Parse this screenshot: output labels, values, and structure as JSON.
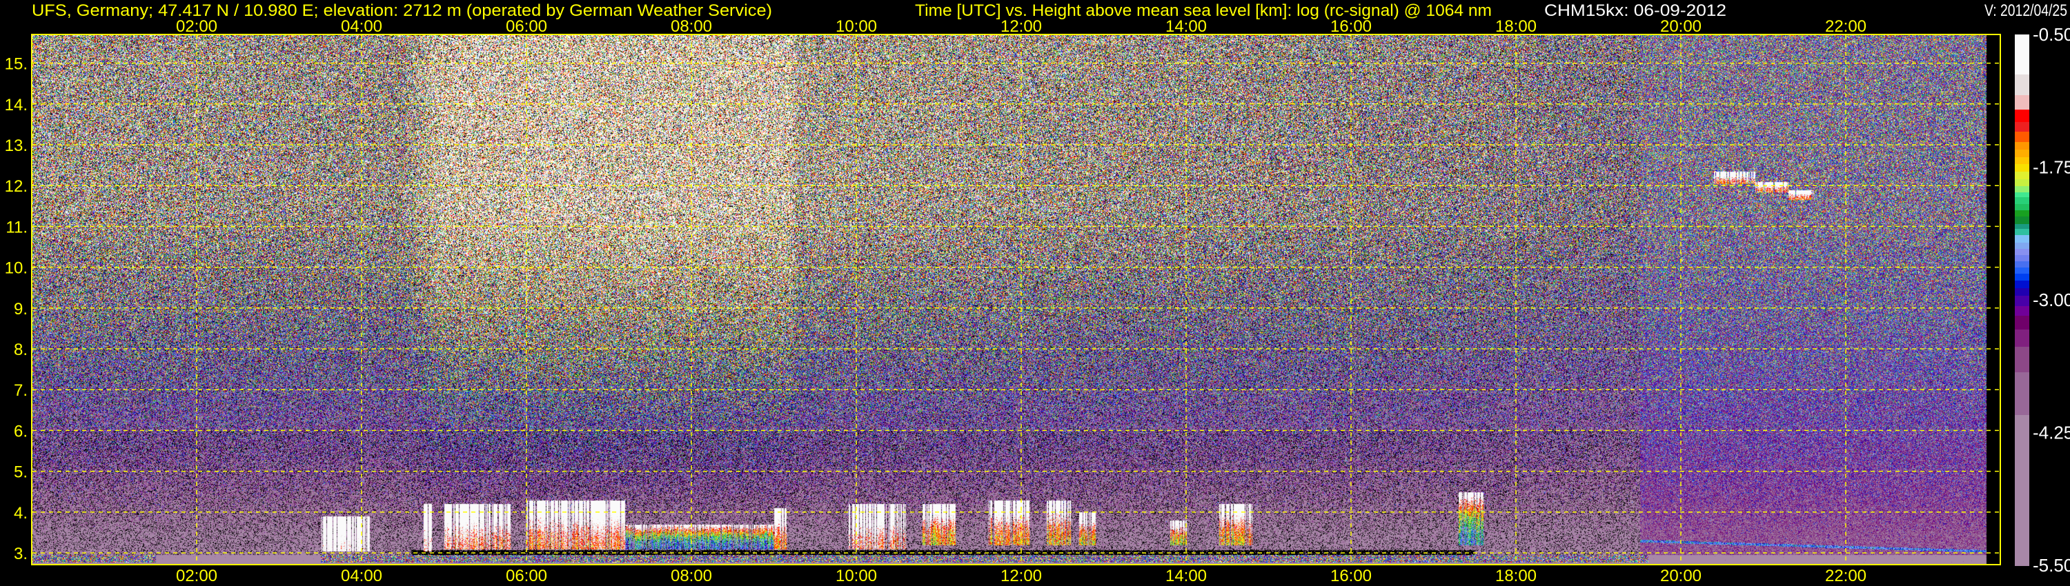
{
  "header": {
    "station": "UFS, Germany; 47.417 N / 10.980 E; elevation: 2712 m  (operated by German Weather Service)",
    "instrument": "CHM15kx: 06-09-2012",
    "version": "V: 2012/04/25"
  },
  "chart_data": {
    "type": "heatmap",
    "title": "Time [UTC] vs. Height above mean sea level [km]: log (rc-signal) @ 1064 nm",
    "xlabel": "Time [UTC]",
    "ylabel": "Height above mean sea level [km]",
    "xlim": [
      0,
      24
    ],
    "ylim": [
      2.73,
      15.7
    ],
    "grid": true,
    "x_ticks": [
      "02:00",
      "04:00",
      "06:00",
      "08:00",
      "10:00",
      "12:00",
      "14:00",
      "16:00",
      "18:00",
      "20:00",
      "22:00"
    ],
    "x_tick_values": [
      2,
      4,
      6,
      8,
      10,
      12,
      14,
      16,
      18,
      20,
      22
    ],
    "y_ticks": [
      "3.",
      "4.",
      "5.",
      "6.",
      "7.",
      "8.",
      "9.",
      "10.",
      "11.",
      "12.",
      "13.",
      "14.",
      "15."
    ],
    "y_tick_values": [
      3,
      4,
      5,
      6,
      7,
      8,
      9,
      10,
      11,
      12,
      13,
      14,
      15
    ],
    "data_end_hour": 23.7,
    "colorbar": {
      "range": [
        -5.5,
        -0.5
      ],
      "ticks": [
        "-0.50",
        "-1.75",
        "-3.00",
        "-4.25",
        "-5.50"
      ],
      "tick_values": [
        -0.5,
        -1.75,
        -3.0,
        -4.25,
        -5.5
      ],
      "colors_top_to_bottom": [
        "#fafafa",
        "#e6dede",
        "#f0bcbc",
        "#ff0000",
        "#ee2020",
        "#ff5a00",
        "#ff9600",
        "#ffae00",
        "#ffc800",
        "#f8e000",
        "#e0f030",
        "#c8f040",
        "#90f070",
        "#40e890",
        "#28d078",
        "#20c060",
        "#18a020",
        "#108c30",
        "#1a9a80",
        "#30c0a0",
        "#80c0f8",
        "#80a8f0",
        "#8890f0",
        "#7080f0",
        "#4870f0",
        "#2060f8",
        "#0040f0",
        "#0010d0",
        "#2000b0",
        "#4800a8",
        "#700098",
        "#70006a",
        "#80207f",
        "#8c4888",
        "#986898",
        "#a888a8"
      ],
      "color_weights": [
        110,
        59,
        40,
        34,
        27,
        29,
        20,
        21,
        20,
        21,
        20,
        20,
        16,
        15,
        19,
        17,
        16,
        21,
        14,
        18,
        21,
        16,
        18,
        16,
        18,
        18,
        19,
        20,
        22,
        28,
        27,
        39,
        47,
        71,
        119,
        416
      ]
    },
    "background_upper_mean": [
      [
        0,
        -1.8
      ],
      [
        4.5,
        -1.9
      ],
      [
        5.0,
        -0.9
      ],
      [
        9.2,
        -0.9
      ],
      [
        9.3,
        -1.6
      ],
      [
        11,
        -1.7
      ],
      [
        15,
        -2.0
      ],
      [
        17.5,
        -2.2
      ],
      [
        19.5,
        -2.6
      ],
      [
        24,
        -2.7
      ]
    ],
    "cloud_features": [
      {
        "t0": 3.5,
        "t1": 4.1,
        "base": 3.05,
        "top": 3.9,
        "peak": -0.6
      },
      {
        "t0": 4.75,
        "t1": 4.85,
        "base": 3.05,
        "top": 4.2,
        "peak": -0.8
      },
      {
        "t0": 5.0,
        "t1": 5.8,
        "base": 3.1,
        "top": 4.2,
        "peak": -1.2
      },
      {
        "t0": 6.0,
        "t1": 7.2,
        "base": 3.1,
        "top": 4.3,
        "peak": -1.3
      },
      {
        "t0": 7.2,
        "t1": 9.0,
        "base": 3.1,
        "top": 3.7,
        "peak": -2.6
      },
      {
        "t0": 9.0,
        "t1": 9.15,
        "base": 3.1,
        "top": 4.1,
        "peak": -1.5
      },
      {
        "t0": 9.9,
        "t1": 10.6,
        "base": 3.1,
        "top": 4.2,
        "peak": -1.2
      },
      {
        "t0": 10.8,
        "t1": 11.2,
        "base": 3.2,
        "top": 4.2,
        "peak": -1.6
      },
      {
        "t0": 11.6,
        "t1": 12.1,
        "base": 3.2,
        "top": 4.3,
        "peak": -1.5
      },
      {
        "t0": 12.3,
        "t1": 12.6,
        "base": 3.2,
        "top": 4.3,
        "peak": -1.6
      },
      {
        "t0": 12.7,
        "t1": 12.9,
        "base": 3.2,
        "top": 4.0,
        "peak": -1.8
      },
      {
        "t0": 13.8,
        "t1": 14.0,
        "base": 3.2,
        "top": 3.8,
        "peak": -1.8
      },
      {
        "t0": 14.4,
        "t1": 14.8,
        "base": 3.2,
        "top": 4.2,
        "peak": -1.7
      },
      {
        "t0": 17.3,
        "t1": 17.6,
        "base": 3.2,
        "top": 4.5,
        "peak": -2.4
      },
      {
        "t0": 20.4,
        "t1": 20.9,
        "base": 12.05,
        "top": 12.35,
        "peak": -1.3
      },
      {
        "t0": 20.9,
        "t1": 21.3,
        "base": 11.85,
        "top": 12.1,
        "peak": -1.3
      },
      {
        "t0": 21.3,
        "t1": 21.6,
        "base": 11.65,
        "top": 11.9,
        "peak": -1.4
      }
    ],
    "colors": {
      "axis": "#ffff00",
      "grid": "#ffff00",
      "text_white": "#ffffff"
    }
  }
}
